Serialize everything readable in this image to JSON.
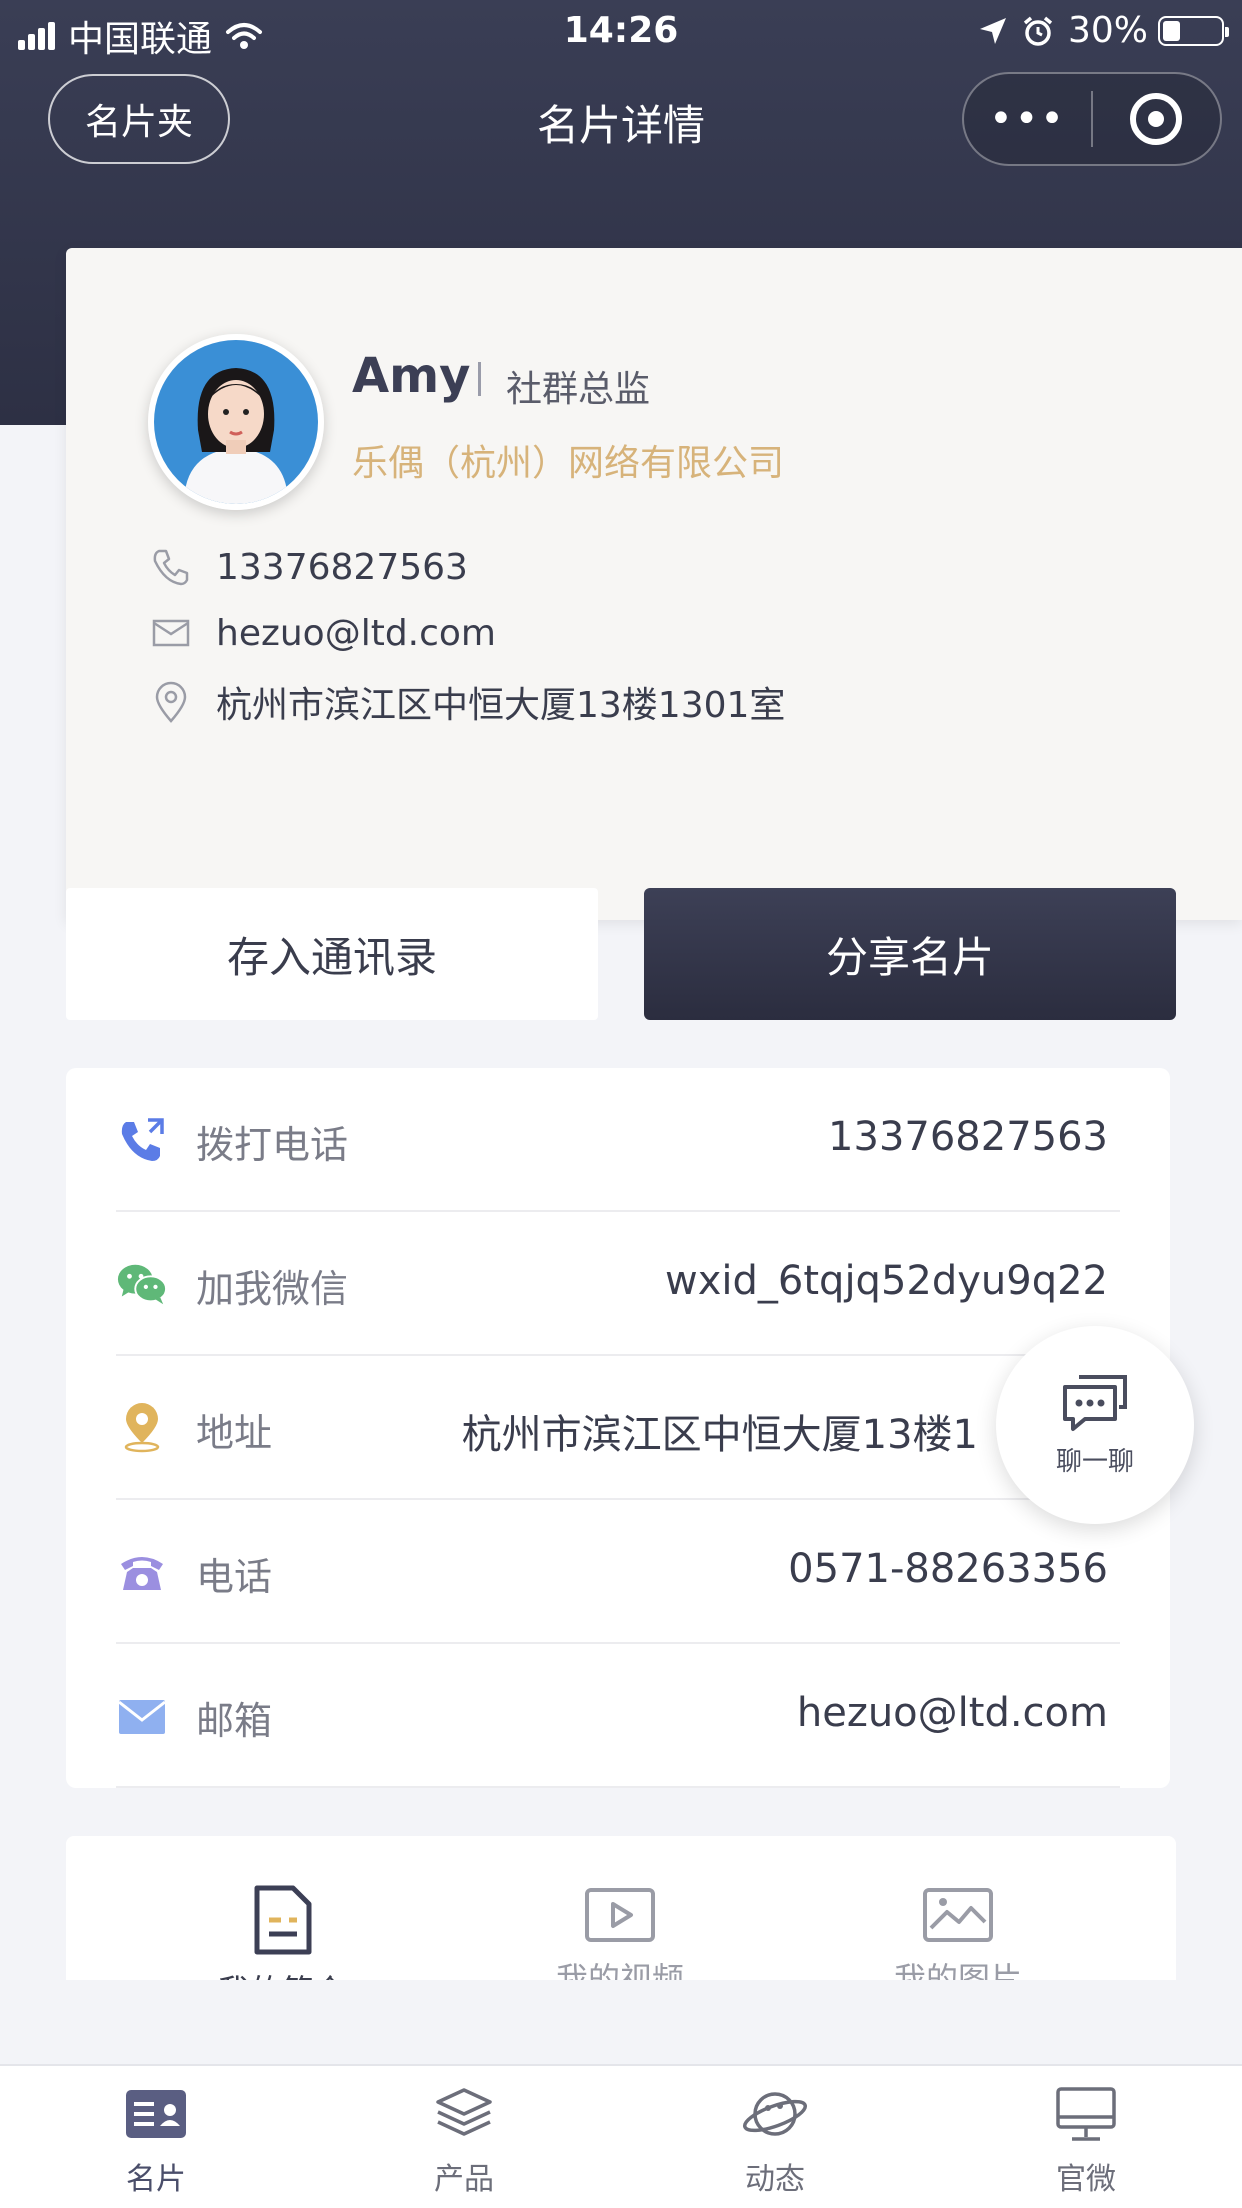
{
  "status_bar": {
    "carrier": "中国联通",
    "time": "14:26",
    "battery": "30%",
    "battery_level": 0.3
  },
  "nav": {
    "back_label": "名片夹",
    "title": "名片详情",
    "more_label": "•••"
  },
  "card": {
    "name": "Amy",
    "title": "社群总监",
    "company": "乐偶（杭州）网络有限公司",
    "phone": "13376827563",
    "email": "hezuo@ltd.com",
    "address": "杭州市滨江区中恒大厦13楼1301室"
  },
  "actions": {
    "save_label": "存入通讯录",
    "share_label": "分享名片"
  },
  "contacts": [
    {
      "label": "拨打电话",
      "value": "13376827563"
    },
    {
      "label": "加我微信",
      "value": "wxid_6tqjq52dyu9q22"
    },
    {
      "label": "地址",
      "value": "杭州市滨江区中恒大厦13楼1"
    },
    {
      "label": "电话",
      "value": "0571-88263356"
    },
    {
      "label": "邮箱",
      "value": "hezuo@ltd.com"
    }
  ],
  "chat_button": {
    "label": "聊一聊"
  },
  "intro_tabs": [
    {
      "label": "我的简介"
    },
    {
      "label": "我的视频"
    },
    {
      "label": "我的图片"
    }
  ],
  "tab_bar": [
    {
      "label": "名片"
    },
    {
      "label": "产品"
    },
    {
      "label": "动态"
    },
    {
      "label": "官微"
    }
  ],
  "colors": {
    "header_dark": "#2d3044",
    "accent_gold": "#d7b37a",
    "phone_blue": "#5b7ce6",
    "wechat_green": "#5fb878",
    "address_gold": "#e0b45c",
    "tel_purple": "#9b8fe0",
    "mail_blue": "#8fb0f0"
  }
}
